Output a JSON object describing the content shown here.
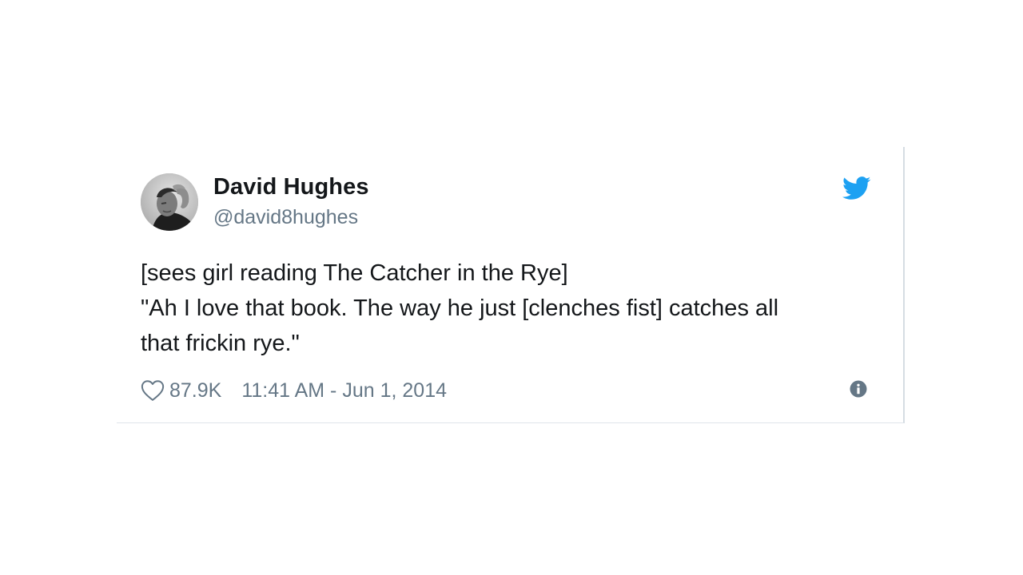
{
  "tweet": {
    "author": {
      "name": "David Hughes",
      "handle": "@david8hughes"
    },
    "text_lines": [
      "[sees girl reading The Catcher in the Rye]",
      "\"Ah I love that book. The way he just [clenches fist] catches all",
      "that frickin rye.\""
    ],
    "likes": "87.9K",
    "timestamp": "11:41 AM - Jun 1, 2014"
  },
  "icons": {
    "avatar": "avatar-photo",
    "brand": "twitter-bird-icon",
    "like": "heart-outline-icon",
    "info": "info-circle-icon"
  },
  "colors": {
    "text": "#14171a",
    "secondary": "#657786",
    "twitter_blue": "#1da1f2",
    "divider": "#dfe5ea"
  }
}
